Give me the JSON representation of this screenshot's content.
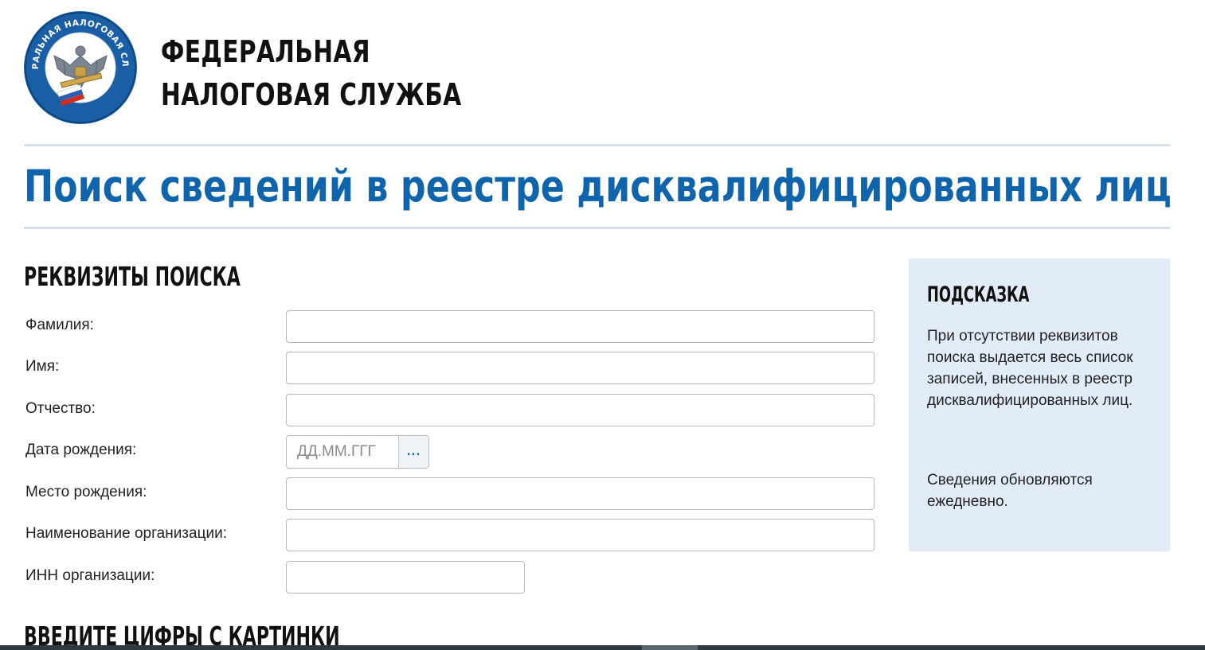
{
  "header": {
    "org_name_line1": "ФЕДЕРАЛЬНАЯ",
    "org_name_line2": "НАЛОГОВАЯ СЛУЖБА",
    "logo_ring_text": "ФЕДЕРАЛЬНАЯ НАЛОГОВАЯ СЛУЖБА",
    "logo_icon": "fns-emblem-logo"
  },
  "page_title": "Поиск сведений в реестре дисквалифицированных лиц",
  "search_section": {
    "title": "РЕКВИЗИТЫ ПОИСКА",
    "fields": {
      "surname": {
        "label": "Фамилия:",
        "value": ""
      },
      "name": {
        "label": "Имя:",
        "value": ""
      },
      "patronymic": {
        "label": "Отчество:",
        "value": ""
      },
      "birth_date": {
        "label": "Дата рождения:",
        "value": "",
        "placeholder": "ДД.ММ.ГГГ",
        "picker_label": "..."
      },
      "birth_place": {
        "label": "Место рождения:",
        "value": ""
      },
      "org_name": {
        "label": "Наименование организации:",
        "value": ""
      },
      "org_inn": {
        "label": "ИНН организации:",
        "value": ""
      }
    }
  },
  "captcha_section": {
    "title": "ВВЕДИТЕ ЦИФРЫ С КАРТИНКИ"
  },
  "hint": {
    "title": "ПОДСКАЗКА",
    "paragraph1": "При отсутствии реквизитов поиска выдается весь список записей, внесенных в реестр дисквалифицированных лиц.",
    "paragraph2": "Сведения обновляются ежедневно."
  },
  "colors": {
    "title_blue": "#0f64ac",
    "hint_background": "#e2ecf8",
    "divider": "#d6dfe8"
  }
}
